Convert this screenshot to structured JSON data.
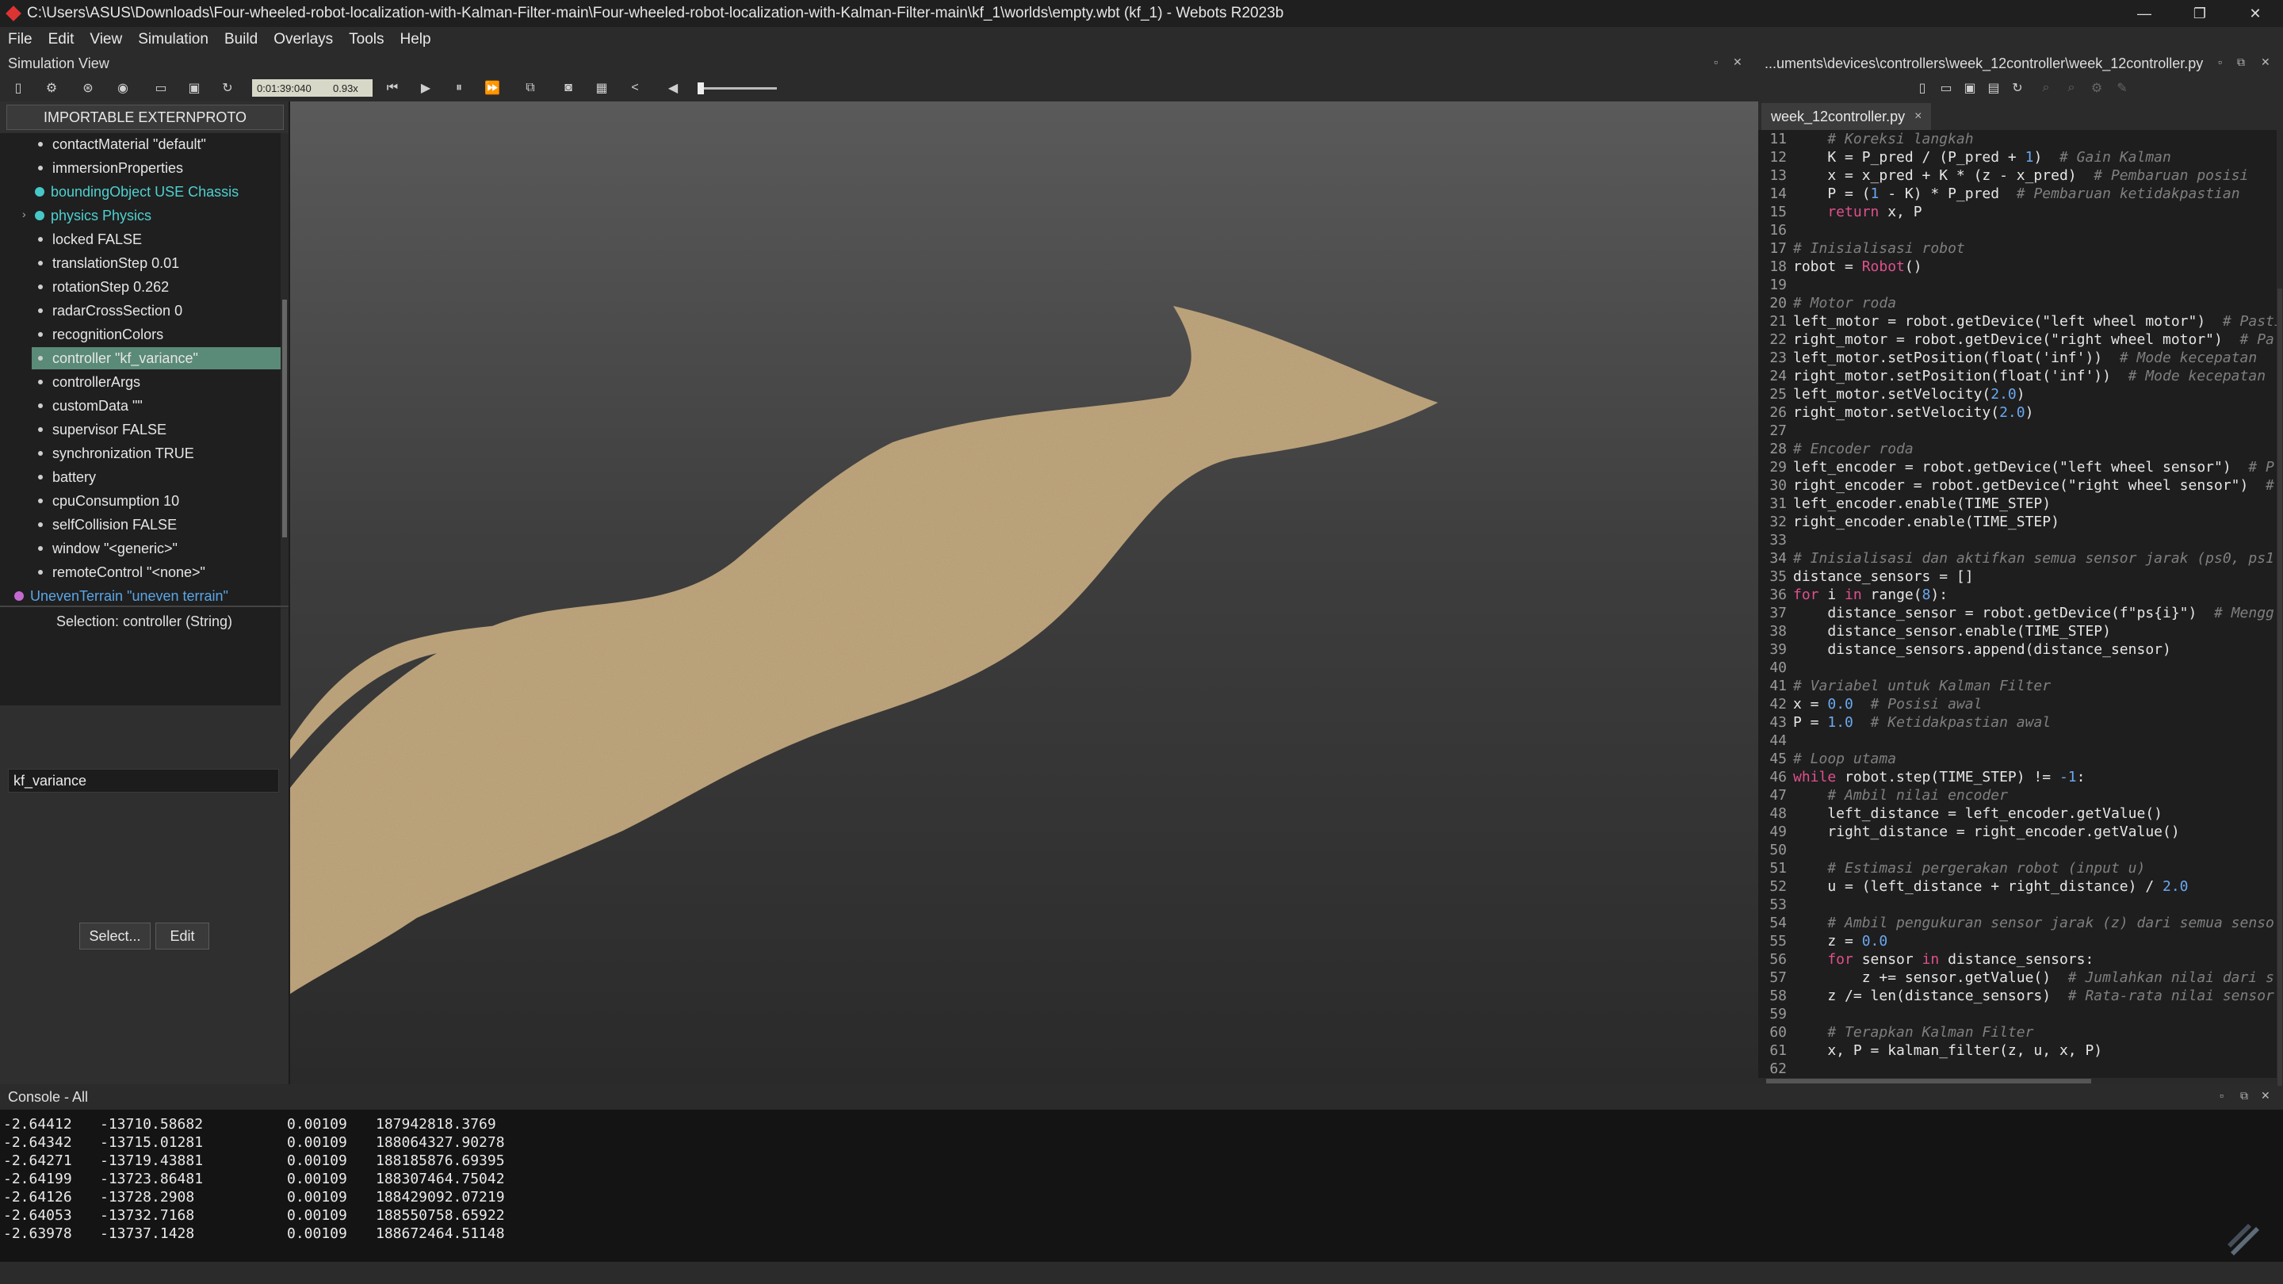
{
  "window": {
    "title": "C:\\Users\\ASUS\\Downloads\\Four-wheeled-robot-localization-with-Kalman-Filter-main\\Four-wheeled-robot-localization-with-Kalman-Filter-main\\kf_1\\worlds\\empty.wbt (kf_1) - Webots R2023b",
    "minimize": "—",
    "maximize": "❐",
    "close": "✕"
  },
  "menu": [
    "File",
    "Edit",
    "View",
    "Simulation",
    "Build",
    "Overlays",
    "Tools",
    "Help"
  ],
  "simulation_view": {
    "label": "Simulation View",
    "time": "0:01:39:040",
    "speed": "0.93x"
  },
  "scene_tree": {
    "extern_button": "IMPORTABLE EXTERNPROTO",
    "nodes": [
      {
        "label": "contactMaterial \"default\""
      },
      {
        "label": "immersionProperties"
      },
      {
        "label": "boundingObject USE Chassis"
      },
      {
        "label": "physics Physics"
      },
      {
        "label": "locked FALSE"
      },
      {
        "label": "translationStep 0.01"
      },
      {
        "label": "rotationStep 0.262"
      },
      {
        "label": "radarCrossSection 0"
      },
      {
        "label": "recognitionColors"
      },
      {
        "label": "controller \"kf_variance\""
      },
      {
        "label": "controllerArgs"
      },
      {
        "label": "customData \"\""
      },
      {
        "label": "supervisor FALSE"
      },
      {
        "label": "synchronization TRUE"
      },
      {
        "label": "battery"
      },
      {
        "label": "cpuConsumption 10"
      },
      {
        "label": "selfCollision FALSE"
      },
      {
        "label": "window \"<generic>\""
      },
      {
        "label": "remoteControl \"<none>\""
      },
      {
        "label": "UnevenTerrain \"uneven terrain\""
      }
    ],
    "expand_arrow": "›",
    "selection": "Selection: controller (String)",
    "controller_value": "kf_variance",
    "select_button": "Select...",
    "edit_button": "Edit"
  },
  "editor": {
    "path": "...uments\\devices\\controllers\\week_12controller\\week_12controller.py",
    "tab": "week_12controller.py",
    "tab_close": "×",
    "lines": [
      {
        "n": "11",
        "parts": [
          [
            "cm",
            "    # Koreksi langkah"
          ]
        ]
      },
      {
        "n": "12",
        "parts": [
          [
            "tx",
            "    K = P_pred / (P_pred + "
          ],
          [
            "num",
            "1"
          ],
          [
            "tx",
            ")  "
          ],
          [
            "cm",
            "# Gain Kalman"
          ]
        ]
      },
      {
        "n": "13",
        "parts": [
          [
            "tx",
            "    x = x_pred + K * (z - x_pred)  "
          ],
          [
            "cm",
            "# Pembaruan posisi"
          ]
        ]
      },
      {
        "n": "14",
        "parts": [
          [
            "tx",
            "    P = ("
          ],
          [
            "num",
            "1"
          ],
          [
            "tx",
            " - K) * P_pred  "
          ],
          [
            "cm",
            "# Pembaruan ketidakpastian"
          ]
        ]
      },
      {
        "n": "15",
        "parts": [
          [
            "kw",
            "    return"
          ],
          [
            "tx",
            " x, P"
          ]
        ]
      },
      {
        "n": "16",
        "parts": [
          [
            "tx",
            ""
          ]
        ]
      },
      {
        "n": "17",
        "parts": [
          [
            "cm",
            "# Inisialisasi robot"
          ]
        ]
      },
      {
        "n": "18",
        "parts": [
          [
            "tx",
            "robot = "
          ],
          [
            "kw",
            "Robot"
          ],
          [
            "tx",
            "()"
          ]
        ]
      },
      {
        "n": "19",
        "parts": [
          [
            "tx",
            ""
          ]
        ]
      },
      {
        "n": "20",
        "parts": [
          [
            "cm",
            "# Motor roda"
          ]
        ]
      },
      {
        "n": "21",
        "parts": [
          [
            "tx",
            "left_motor = robot.getDevice(\"left wheel motor\")  "
          ],
          [
            "cm",
            "# Pasti"
          ]
        ]
      },
      {
        "n": "22",
        "parts": [
          [
            "tx",
            "right_motor = robot.getDevice(\"right wheel motor\")  "
          ],
          [
            "cm",
            "# Pa"
          ]
        ]
      },
      {
        "n": "23",
        "parts": [
          [
            "tx",
            "left_motor.setPosition(float('inf'))  "
          ],
          [
            "cm",
            "# Mode kecepatan"
          ]
        ]
      },
      {
        "n": "24",
        "parts": [
          [
            "tx",
            "right_motor.setPosition(float('inf'))  "
          ],
          [
            "cm",
            "# Mode kecepatan"
          ]
        ]
      },
      {
        "n": "25",
        "parts": [
          [
            "tx",
            "left_motor.setVelocity("
          ],
          [
            "num",
            "2.0"
          ],
          [
            "tx",
            ")"
          ]
        ]
      },
      {
        "n": "26",
        "parts": [
          [
            "tx",
            "right_motor.setVelocity("
          ],
          [
            "num",
            "2.0"
          ],
          [
            "tx",
            ")"
          ]
        ]
      },
      {
        "n": "27",
        "parts": [
          [
            "tx",
            ""
          ]
        ]
      },
      {
        "n": "28",
        "parts": [
          [
            "cm",
            "# Encoder roda"
          ]
        ]
      },
      {
        "n": "29",
        "parts": [
          [
            "tx",
            "left_encoder = robot.getDevice(\"left wheel sensor\")  "
          ],
          [
            "cm",
            "# P"
          ]
        ]
      },
      {
        "n": "30",
        "parts": [
          [
            "tx",
            "right_encoder = robot.getDevice(\"right wheel sensor\")  "
          ],
          [
            "cm",
            "#"
          ]
        ]
      },
      {
        "n": "31",
        "parts": [
          [
            "tx",
            "left_encoder.enable(TIME_STEP)"
          ]
        ]
      },
      {
        "n": "32",
        "parts": [
          [
            "tx",
            "right_encoder.enable(TIME_STEP)"
          ]
        ]
      },
      {
        "n": "33",
        "parts": [
          [
            "tx",
            ""
          ]
        ]
      },
      {
        "n": "34",
        "parts": [
          [
            "cm",
            "# Inisialisasi dan aktifkan semua sensor jarak (ps0, ps1"
          ]
        ]
      },
      {
        "n": "35",
        "parts": [
          [
            "tx",
            "distance_sensors = []"
          ]
        ]
      },
      {
        "n": "36",
        "parts": [
          [
            "kw",
            "for"
          ],
          [
            "tx",
            " i "
          ],
          [
            "kw",
            "in"
          ],
          [
            "tx",
            " range("
          ],
          [
            "num",
            "8"
          ],
          [
            "tx",
            "):"
          ]
        ]
      },
      {
        "n": "37",
        "parts": [
          [
            "tx",
            "    distance_sensor = robot.getDevice(f\"ps{i}\")  "
          ],
          [
            "cm",
            "# Mengg"
          ]
        ]
      },
      {
        "n": "38",
        "parts": [
          [
            "tx",
            "    distance_sensor.enable(TIME_STEP)"
          ]
        ]
      },
      {
        "n": "39",
        "parts": [
          [
            "tx",
            "    distance_sensors.append(distance_sensor)"
          ]
        ]
      },
      {
        "n": "40",
        "parts": [
          [
            "tx",
            ""
          ]
        ]
      },
      {
        "n": "41",
        "parts": [
          [
            "cm",
            "# Variabel untuk Kalman Filter"
          ]
        ]
      },
      {
        "n": "42",
        "parts": [
          [
            "tx",
            "x = "
          ],
          [
            "num",
            "0.0"
          ],
          [
            "tx",
            "  "
          ],
          [
            "cm",
            "# Posisi awal"
          ]
        ]
      },
      {
        "n": "43",
        "parts": [
          [
            "tx",
            "P = "
          ],
          [
            "num",
            "1.0"
          ],
          [
            "tx",
            "  "
          ],
          [
            "cm",
            "# Ketidakpastian awal"
          ]
        ]
      },
      {
        "n": "44",
        "parts": [
          [
            "tx",
            ""
          ]
        ]
      },
      {
        "n": "45",
        "parts": [
          [
            "cm",
            "# Loop utama"
          ]
        ]
      },
      {
        "n": "46",
        "parts": [
          [
            "kw",
            "while"
          ],
          [
            "tx",
            " robot.step(TIME_STEP) != "
          ],
          [
            "num",
            "-1"
          ],
          [
            "tx",
            ":"
          ]
        ]
      },
      {
        "n": "47",
        "parts": [
          [
            "cm",
            "    # Ambil nilai encoder"
          ]
        ]
      },
      {
        "n": "48",
        "parts": [
          [
            "tx",
            "    left_distance = left_encoder.getValue()"
          ]
        ]
      },
      {
        "n": "49",
        "parts": [
          [
            "tx",
            "    right_distance = right_encoder.getValue()"
          ]
        ]
      },
      {
        "n": "50",
        "parts": [
          [
            "tx",
            ""
          ]
        ]
      },
      {
        "n": "51",
        "parts": [
          [
            "cm",
            "    # Estimasi pergerakan robot (input u)"
          ]
        ]
      },
      {
        "n": "52",
        "parts": [
          [
            "tx",
            "    u = (left_distance + right_distance) / "
          ],
          [
            "num",
            "2.0"
          ]
        ]
      },
      {
        "n": "53",
        "parts": [
          [
            "tx",
            ""
          ]
        ]
      },
      {
        "n": "54",
        "parts": [
          [
            "cm",
            "    # Ambil pengukuran sensor jarak (z) dari semua senso"
          ]
        ]
      },
      {
        "n": "55",
        "parts": [
          [
            "tx",
            "    z = "
          ],
          [
            "num",
            "0.0"
          ]
        ]
      },
      {
        "n": "56",
        "parts": [
          [
            "kw",
            "    for"
          ],
          [
            "tx",
            " sensor "
          ],
          [
            "kw",
            "in"
          ],
          [
            "tx",
            " distance_sensors:"
          ]
        ]
      },
      {
        "n": "57",
        "parts": [
          [
            "tx",
            "        z += sensor.getValue()  "
          ],
          [
            "cm",
            "# Jumlahkan nilai dari s"
          ]
        ]
      },
      {
        "n": "58",
        "parts": [
          [
            "tx",
            "    z /= len(distance_sensors)  "
          ],
          [
            "cm",
            "# Rata-rata nilai sensor"
          ]
        ]
      },
      {
        "n": "59",
        "parts": [
          [
            "tx",
            ""
          ]
        ]
      },
      {
        "n": "60",
        "parts": [
          [
            "cm",
            "    # Terapkan Kalman Filter"
          ]
        ]
      },
      {
        "n": "61",
        "parts": [
          [
            "tx",
            "    x, P = kalman_filter(z, u, x, P)"
          ]
        ]
      },
      {
        "n": "62",
        "parts": [
          [
            "tx",
            ""
          ]
        ]
      }
    ]
  },
  "console": {
    "label": "Console - All",
    "rows": [
      [
        "-2.64412",
        "-13710.58682",
        "0.00109",
        "187942818.3769"
      ],
      [
        "-2.64342",
        "-13715.01281",
        "0.00109",
        "188064327.90278"
      ],
      [
        "-2.64271",
        "-13719.43881",
        "0.00109",
        "188185876.69395"
      ],
      [
        "-2.64199",
        "-13723.86481",
        "0.00109",
        "188307464.75042"
      ],
      [
        "-2.64126",
        "-13728.2908",
        "0.00109",
        "188429092.07219"
      ],
      [
        "-2.64053",
        "-13732.7168",
        "0.00109",
        "188550758.65922"
      ],
      [
        "-2.63978",
        "-13737.1428",
        "0.00109",
        "188672464.51148"
      ]
    ]
  },
  "colors": {
    "terrain": "#c2a77d",
    "selected_row": "#5a8a78",
    "cyan_node": "#4fd0d0",
    "keyword": "#e0508c",
    "number": "#6aa8f0"
  }
}
